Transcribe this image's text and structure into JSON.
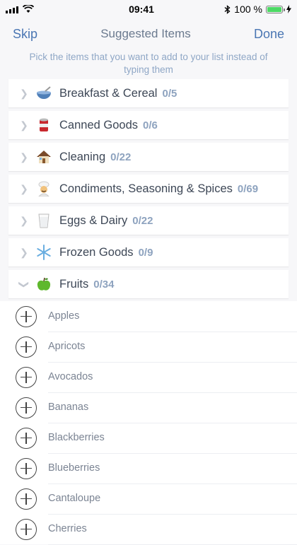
{
  "status": {
    "time": "09:41",
    "battery": "100 %",
    "signal_icon": "signal-bars-icon",
    "wifi_icon": "wifi-icon",
    "bluetooth_icon": "bluetooth-icon",
    "battery_level": 1.0
  },
  "nav": {
    "left": "Skip",
    "title": "Suggested Items",
    "right": "Done"
  },
  "hint": "Pick the items that you want to add to your list instead of typing them",
  "categories": [
    {
      "label": "Breakfast & Cereal",
      "count": "0/5",
      "icon": "cereal-bowl-icon",
      "expanded": false
    },
    {
      "label": "Canned Goods",
      "count": "0/6",
      "icon": "can-icon",
      "expanded": false
    },
    {
      "label": "Cleaning",
      "count": "0/22",
      "icon": "house-icon",
      "expanded": false
    },
    {
      "label": "Condiments, Seasoning & Spices",
      "count": "0/69",
      "icon": "chef-icon",
      "expanded": false
    },
    {
      "label": "Eggs & Dairy",
      "count": "0/22",
      "icon": "milk-glass-icon",
      "expanded": false
    },
    {
      "label": "Frozen Goods",
      "count": "0/9",
      "icon": "snowflake-icon",
      "expanded": false
    },
    {
      "label": "Fruits",
      "count": "0/34",
      "icon": "green-apple-icon",
      "expanded": true
    }
  ],
  "fruits": [
    "Apples",
    "Apricots",
    "Avocados",
    "Bananas",
    "Blackberries",
    "Blueberries",
    "Cantaloupe",
    "Cherries"
  ]
}
